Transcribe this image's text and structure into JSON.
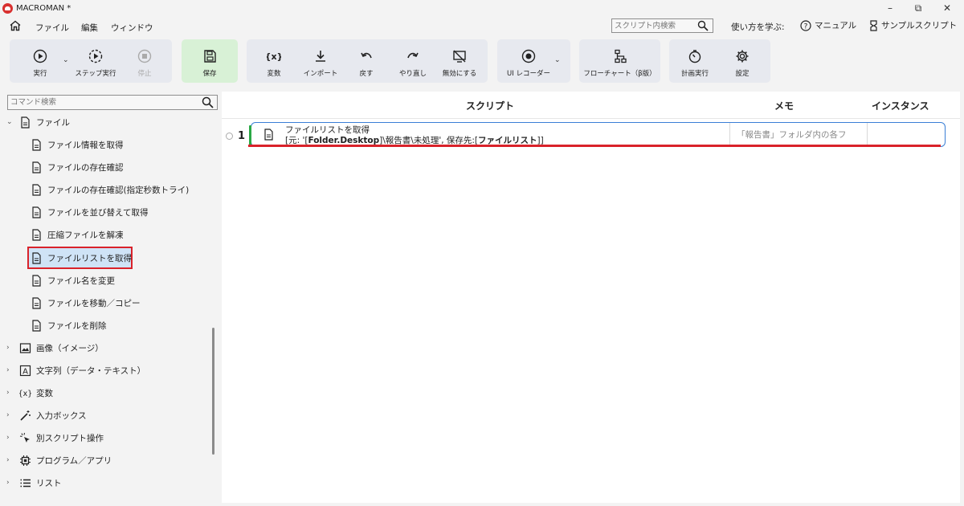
{
  "window": {
    "title": "MACROMAN *",
    "minimize": "–",
    "restore": "⧉",
    "close": "✕"
  },
  "menu": {
    "items": [
      "ファイル",
      "編集",
      "ウィンドウ"
    ],
    "search_placeholder": "スクリプト内検索",
    "learn": "使い方を学ぶ:",
    "manual": "マニュアル",
    "samples": "サンプルスクリプト"
  },
  "toolbar": {
    "run": "実行",
    "step_run": "ステップ実行",
    "stop": "停止",
    "save": "保存",
    "variables": "変数",
    "import": "インポート",
    "undo": "戻す",
    "redo": "やり直し",
    "disable": "無効にする",
    "ui_recorder": "UI レコーダー",
    "flowchart": "フローチャート（β版）",
    "scheduled_run": "計画実行",
    "settings": "設定",
    "save_bg": "#d8f1d6"
  },
  "sidebar": {
    "search_placeholder": "コマンド検索",
    "file_category": "ファイル",
    "file_commands": [
      "ファイル情報を取得",
      "ファイルの存在確認",
      "ファイルの存在確認(指定秒数トライ)",
      "ファイルを並び替えて取得",
      "圧縮ファイルを解凍",
      "ファイルリストを取得",
      "ファイル名を変更",
      "ファイルを移動／コピー",
      "ファイルを削除"
    ],
    "categories": [
      "画像（イメージ）",
      "文字列（データ・テキスト）",
      "変数",
      "入力ボックス",
      "別スクリプト操作",
      "プログラム／アプリ",
      "リスト"
    ]
  },
  "main": {
    "columns": {
      "script": "スクリプト",
      "memo": "メモ",
      "instance": "インスタンス"
    },
    "rows": [
      {
        "number": "1",
        "title": "ファイルリストを取得",
        "params_prefix": "[元: '[",
        "params_var1": "Folder.Desktop",
        "params_mid": "]\\報告書\\未処理', 保存先:[",
        "params_var2": "ファイルリスト",
        "params_suffix": "]]",
        "memo": "「報告書」フォルダ内の各フ",
        "instance": ""
      }
    ]
  },
  "colors": {
    "accent": "#3a7fd6",
    "highlight_red": "#d9222a",
    "row_marker": "#2aa845"
  }
}
